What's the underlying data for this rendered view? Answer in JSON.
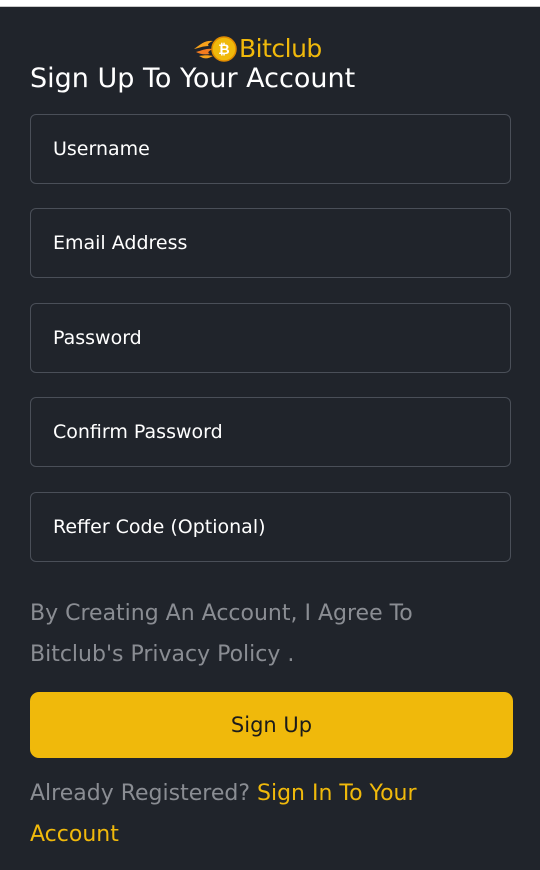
{
  "brand": {
    "name": "Bitclub",
    "logo_icon": "flaming-bitcoin-coin-icon",
    "accent_color": "#f0b90b",
    "background_color": "#20242b"
  },
  "page_title": "Sign Up To Your Account",
  "form": {
    "username_placeholder": "Username",
    "email_placeholder": "Email Address",
    "password_placeholder": "Password",
    "confirm_password_placeholder": "Confirm Password",
    "referral_code_placeholder": "Reffer Code (Optional)"
  },
  "terms_text": "By Creating An Account, I Agree To Bitclub's Privacy Policy .",
  "signup_button_label": "Sign Up",
  "footer": {
    "already_registered_text": "Already Registered?",
    "signin_link_label": "Sign In To Your Account"
  }
}
